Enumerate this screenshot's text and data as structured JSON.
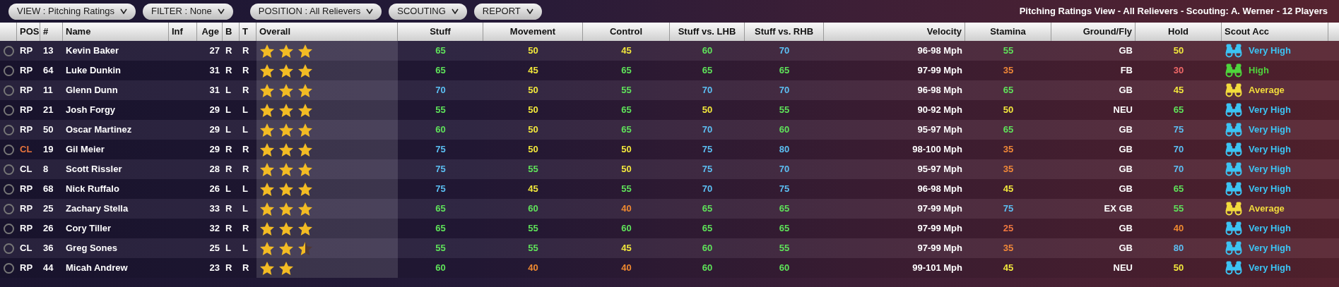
{
  "toolbar": {
    "menus": [
      {
        "label": "VIEW : Pitching Ratings"
      },
      {
        "label": "FILTER : None"
      },
      {
        "label": "POSITION : All Relievers"
      },
      {
        "label": "SCOUTING"
      },
      {
        "label": "REPORT"
      }
    ],
    "summary": "Pitching Ratings View - All Relievers - Scouting: A. Werner - 12 Players"
  },
  "table": {
    "columns": [
      "POS",
      "#",
      "Name",
      "Inf",
      "Age",
      "B",
      "T",
      "Overall",
      "Stuff",
      "Movement",
      "Control",
      "Stuff vs. LHB",
      "Stuff vs. RHB",
      "Velocity",
      "Stamina",
      "Ground/Fly",
      "Hold",
      "Scout Acc"
    ],
    "rows": [
      {
        "selected": false,
        "pos": "RP",
        "highlighted": false,
        "number": "13",
        "name": "Kevin Baker",
        "age": "27",
        "bats": "R",
        "throws": "R",
        "stars": 3,
        "ratings": [
          {
            "value": "65",
            "color": "#5fe35a"
          },
          {
            "value": "50",
            "color": "#f2e83c"
          },
          {
            "value": "45",
            "color": "#f2e83c"
          },
          {
            "value": "60",
            "color": "#5fe35a"
          },
          {
            "value": "70",
            "color": "#5cc0f4"
          }
        ],
        "velocity": "96-98 Mph",
        "stamina": {
          "value": "55",
          "color": "#5fe35a"
        },
        "ground_fly": "GB",
        "hold": {
          "value": "50",
          "color": "#f2e83c"
        },
        "scout": {
          "label": "Very High",
          "color": "#3cc4f4"
        }
      },
      {
        "selected": false,
        "pos": "RP",
        "highlighted": false,
        "number": "64",
        "name": "Luke Dunkin",
        "age": "31",
        "bats": "R",
        "throws": "R",
        "stars": 3,
        "ratings": [
          {
            "value": "65",
            "color": "#5fe35a"
          },
          {
            "value": "45",
            "color": "#f2e83c"
          },
          {
            "value": "65",
            "color": "#5fe35a"
          },
          {
            "value": "65",
            "color": "#5fe35a"
          },
          {
            "value": "65",
            "color": "#5fe35a"
          }
        ],
        "velocity": "97-99 Mph",
        "stamina": {
          "value": "35",
          "color": "#f08838"
        },
        "ground_fly": "FB",
        "hold": {
          "value": "30",
          "color": "#f06868"
        },
        "scout": {
          "label": "High",
          "color": "#4fd43c"
        }
      },
      {
        "selected": false,
        "pos": "RP",
        "highlighted": false,
        "number": "11",
        "name": "Glenn Dunn",
        "age": "31",
        "bats": "L",
        "throws": "R",
        "stars": 3,
        "ratings": [
          {
            "value": "70",
            "color": "#5cc0f4"
          },
          {
            "value": "50",
            "color": "#f2e83c"
          },
          {
            "value": "55",
            "color": "#5fe35a"
          },
          {
            "value": "70",
            "color": "#5cc0f4"
          },
          {
            "value": "70",
            "color": "#5cc0f4"
          }
        ],
        "velocity": "96-98 Mph",
        "stamina": {
          "value": "65",
          "color": "#5fe35a"
        },
        "ground_fly": "GB",
        "hold": {
          "value": "45",
          "color": "#f2e83c"
        },
        "scout": {
          "label": "Average",
          "color": "#f2dc3c"
        }
      },
      {
        "selected": false,
        "pos": "RP",
        "highlighted": false,
        "number": "21",
        "name": "Josh Forgy",
        "age": "29",
        "bats": "L",
        "throws": "L",
        "stars": 3,
        "ratings": [
          {
            "value": "55",
            "color": "#5fe35a"
          },
          {
            "value": "50",
            "color": "#f2e83c"
          },
          {
            "value": "65",
            "color": "#5fe35a"
          },
          {
            "value": "50",
            "color": "#f2e83c"
          },
          {
            "value": "55",
            "color": "#5fe35a"
          }
        ],
        "velocity": "90-92 Mph",
        "stamina": {
          "value": "50",
          "color": "#f2e83c"
        },
        "ground_fly": "NEU",
        "hold": {
          "value": "65",
          "color": "#5fe35a"
        },
        "scout": {
          "label": "Very High",
          "color": "#3cc4f4"
        }
      },
      {
        "selected": false,
        "pos": "RP",
        "highlighted": false,
        "number": "50",
        "name": "Oscar Martinez",
        "age": "29",
        "bats": "L",
        "throws": "L",
        "stars": 3,
        "ratings": [
          {
            "value": "60",
            "color": "#5fe35a"
          },
          {
            "value": "50",
            "color": "#f2e83c"
          },
          {
            "value": "65",
            "color": "#5fe35a"
          },
          {
            "value": "70",
            "color": "#5cc0f4"
          },
          {
            "value": "60",
            "color": "#5fe35a"
          }
        ],
        "velocity": "95-97 Mph",
        "stamina": {
          "value": "65",
          "color": "#5fe35a"
        },
        "ground_fly": "GB",
        "hold": {
          "value": "75",
          "color": "#5cc0f4"
        },
        "scout": {
          "label": "Very High",
          "color": "#3cc4f4"
        }
      },
      {
        "selected": false,
        "pos": "CL",
        "highlighted": true,
        "number": "19",
        "name": "Gil Meier",
        "age": "29",
        "bats": "R",
        "throws": "R",
        "stars": 3,
        "ratings": [
          {
            "value": "75",
            "color": "#5cc0f4"
          },
          {
            "value": "50",
            "color": "#f2e83c"
          },
          {
            "value": "50",
            "color": "#f2e83c"
          },
          {
            "value": "75",
            "color": "#5cc0f4"
          },
          {
            "value": "80",
            "color": "#5cc0f4"
          }
        ],
        "velocity": "98-100 Mph",
        "stamina": {
          "value": "35",
          "color": "#f08838"
        },
        "ground_fly": "GB",
        "hold": {
          "value": "70",
          "color": "#5cc0f4"
        },
        "scout": {
          "label": "Very High",
          "color": "#3cc4f4"
        }
      },
      {
        "selected": false,
        "pos": "CL",
        "highlighted": false,
        "number": "8",
        "name": "Scott Rissler",
        "age": "28",
        "bats": "R",
        "throws": "R",
        "stars": 3,
        "ratings": [
          {
            "value": "75",
            "color": "#5cc0f4"
          },
          {
            "value": "55",
            "color": "#5fe35a"
          },
          {
            "value": "50",
            "color": "#f2e83c"
          },
          {
            "value": "75",
            "color": "#5cc0f4"
          },
          {
            "value": "70",
            "color": "#5cc0f4"
          }
        ],
        "velocity": "95-97 Mph",
        "stamina": {
          "value": "35",
          "color": "#f08838"
        },
        "ground_fly": "GB",
        "hold": {
          "value": "70",
          "color": "#5cc0f4"
        },
        "scout": {
          "label": "Very High",
          "color": "#3cc4f4"
        }
      },
      {
        "selected": false,
        "pos": "RP",
        "highlighted": false,
        "number": "68",
        "name": "Nick Ruffalo",
        "age": "26",
        "bats": "L",
        "throws": "L",
        "stars": 3,
        "ratings": [
          {
            "value": "75",
            "color": "#5cc0f4"
          },
          {
            "value": "45",
            "color": "#f2e83c"
          },
          {
            "value": "55",
            "color": "#5fe35a"
          },
          {
            "value": "70",
            "color": "#5cc0f4"
          },
          {
            "value": "75",
            "color": "#5cc0f4"
          }
        ],
        "velocity": "96-98 Mph",
        "stamina": {
          "value": "45",
          "color": "#f2e83c"
        },
        "ground_fly": "GB",
        "hold": {
          "value": "65",
          "color": "#5fe35a"
        },
        "scout": {
          "label": "Very High",
          "color": "#3cc4f4"
        }
      },
      {
        "selected": false,
        "pos": "RP",
        "highlighted": false,
        "number": "25",
        "name": "Zachary Stella",
        "age": "33",
        "bats": "R",
        "throws": "L",
        "stars": 3,
        "ratings": [
          {
            "value": "65",
            "color": "#5fe35a"
          },
          {
            "value": "60",
            "color": "#5fe35a"
          },
          {
            "value": "40",
            "color": "#f08a30"
          },
          {
            "value": "65",
            "color": "#5fe35a"
          },
          {
            "value": "65",
            "color": "#5fe35a"
          }
        ],
        "velocity": "97-99 Mph",
        "stamina": {
          "value": "75",
          "color": "#5cc0f4"
        },
        "ground_fly": "EX GB",
        "hold": {
          "value": "55",
          "color": "#5fe35a"
        },
        "scout": {
          "label": "Average",
          "color": "#f2dc3c"
        }
      },
      {
        "selected": false,
        "pos": "RP",
        "highlighted": false,
        "number": "26",
        "name": "Cory Tiller",
        "age": "32",
        "bats": "R",
        "throws": "R",
        "stars": 3,
        "ratings": [
          {
            "value": "65",
            "color": "#5fe35a"
          },
          {
            "value": "55",
            "color": "#5fe35a"
          },
          {
            "value": "60",
            "color": "#5fe35a"
          },
          {
            "value": "65",
            "color": "#5fe35a"
          },
          {
            "value": "65",
            "color": "#5fe35a"
          }
        ],
        "velocity": "97-99 Mph",
        "stamina": {
          "value": "25",
          "color": "#f07840"
        },
        "ground_fly": "GB",
        "hold": {
          "value": "40",
          "color": "#f08a30"
        },
        "scout": {
          "label": "Very High",
          "color": "#3cc4f4"
        }
      },
      {
        "selected": false,
        "pos": "CL",
        "highlighted": false,
        "number": "36",
        "name": "Greg Sones",
        "age": "25",
        "bats": "L",
        "throws": "L",
        "stars": 2.5,
        "ratings": [
          {
            "value": "55",
            "color": "#5fe35a"
          },
          {
            "value": "55",
            "color": "#5fe35a"
          },
          {
            "value": "45",
            "color": "#f2e83c"
          },
          {
            "value": "60",
            "color": "#5fe35a"
          },
          {
            "value": "55",
            "color": "#5fe35a"
          }
        ],
        "velocity": "97-99 Mph",
        "stamina": {
          "value": "35",
          "color": "#f08838"
        },
        "ground_fly": "GB",
        "hold": {
          "value": "80",
          "color": "#5cc0f4"
        },
        "scout": {
          "label": "Very High",
          "color": "#3cc4f4"
        }
      },
      {
        "selected": false,
        "pos": "RP",
        "highlighted": false,
        "number": "44",
        "name": "Micah Andrew",
        "age": "23",
        "bats": "R",
        "throws": "R",
        "stars": 2,
        "ratings": [
          {
            "value": "60",
            "color": "#5fe35a"
          },
          {
            "value": "40",
            "color": "#f08a30"
          },
          {
            "value": "40",
            "color": "#f08a30"
          },
          {
            "value": "60",
            "color": "#5fe35a"
          },
          {
            "value": "60",
            "color": "#5fe35a"
          }
        ],
        "velocity": "99-101 Mph",
        "stamina": {
          "value": "45",
          "color": "#f2e83c"
        },
        "ground_fly": "NEU",
        "hold": {
          "value": "50",
          "color": "#f2e83c"
        },
        "scout": {
          "label": "Very High",
          "color": "#3cc4f4"
        }
      }
    ]
  }
}
